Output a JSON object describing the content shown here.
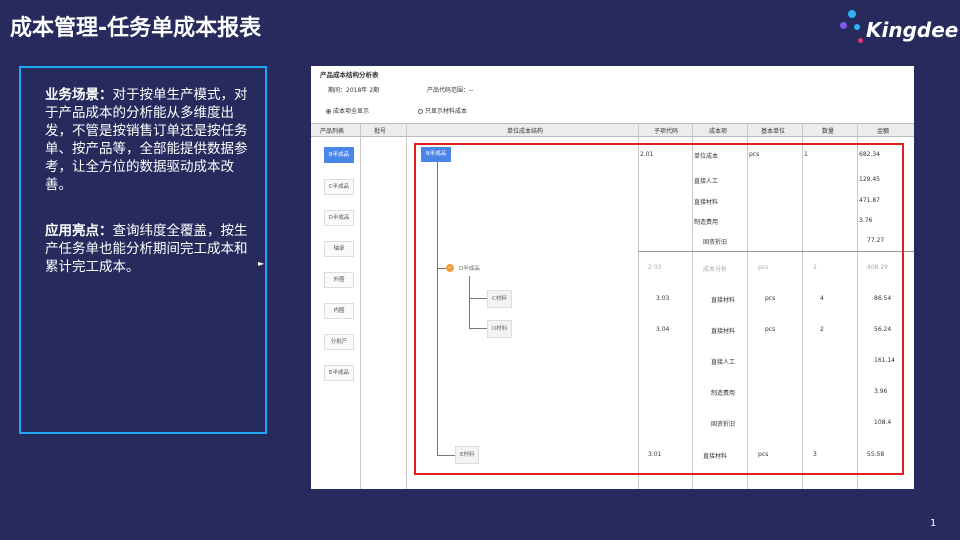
{
  "slide": {
    "title": "成本管理-任务单成本报表",
    "logo_text": "Kingdee",
    "page_number": "1",
    "scenario_label": "业务场景：",
    "scenario_text": "对于按单生产模式，对于产品成本的分析能从多维度出发，不管是按销售订单还是按任务单、按产品等，全部能提供数据参考，让全方位的数据驱动成本改善。",
    "highlight_label": "应用亮点：",
    "highlight_text": "查询纬度全覆盖，按生产任务单也能分析期间完工成本和累计完工成本。",
    "colors": {
      "background": "#262a5c",
      "box_border": "#1ea7f5",
      "logo_dot_a": "#2ab4f0",
      "logo_dot_b": "#7b5cf0",
      "logo_dot_c": "#e4387a"
    }
  },
  "report": {
    "title": "产品成本结构分析表",
    "period_label": "期间：",
    "period_value": "2018年  2期",
    "range_label": "产品代码范围：",
    "range_value": "--",
    "radio_all": "成本项全显示",
    "radio_material": "只显示材料成本",
    "radio_selected": "成本项全显示",
    "columns": [
      "产品列表",
      "批号",
      "单位成本结构",
      "子项代码",
      "成本项",
      "基本单位",
      "数量",
      "金额"
    ],
    "products": [
      "B半成品",
      "C半成品",
      "D半成品",
      "轴承",
      "外圈",
      "内圈",
      "分批产",
      "E半成品"
    ],
    "selected_product": "B半成品",
    "tree": {
      "root": "B半成品",
      "child": "D半成品",
      "leaf1": "C材料",
      "leaf2": "D材料",
      "leaf3": "E材料"
    },
    "rows": [
      {
        "code": "2.01",
        "item": "单位成本",
        "unit": "pcs",
        "qty": "1",
        "amount": "682.34"
      },
      {
        "code": "",
        "item": "直接人工",
        "unit": "",
        "qty": "",
        "amount": "129.45"
      },
      {
        "code": "",
        "item": "直接材料",
        "unit": "",
        "qty": "",
        "amount": "471.87"
      },
      {
        "code": "",
        "item": "制造费用",
        "unit": "",
        "qty": "",
        "amount": "3.76"
      },
      {
        "code": "",
        "item": "固资折旧",
        "unit": "",
        "qty": "",
        "amount": "77.27"
      },
      {
        "code": "2.03",
        "item": "成本分析",
        "unit": "pcs",
        "qty": "2",
        "amount": "408.29"
      },
      {
        "code": "3.03",
        "item": "直接材料",
        "unit": "pcs",
        "qty": "4",
        "amount": "86.54"
      },
      {
        "code": "3.04",
        "item": "直接材料",
        "unit": "pcs",
        "qty": "2",
        "amount": "56.24"
      },
      {
        "code": "",
        "item": "直接人工",
        "unit": "",
        "qty": "",
        "amount": "161.14"
      },
      {
        "code": "",
        "item": "制造费用",
        "unit": "",
        "qty": "",
        "amount": "3.96"
      },
      {
        "code": "",
        "item": "固资折旧",
        "unit": "",
        "qty": "",
        "amount": "108.4"
      },
      {
        "code": "3.01",
        "item": "直接材料",
        "unit": "pcs",
        "qty": "3",
        "amount": "55.58"
      }
    ]
  }
}
